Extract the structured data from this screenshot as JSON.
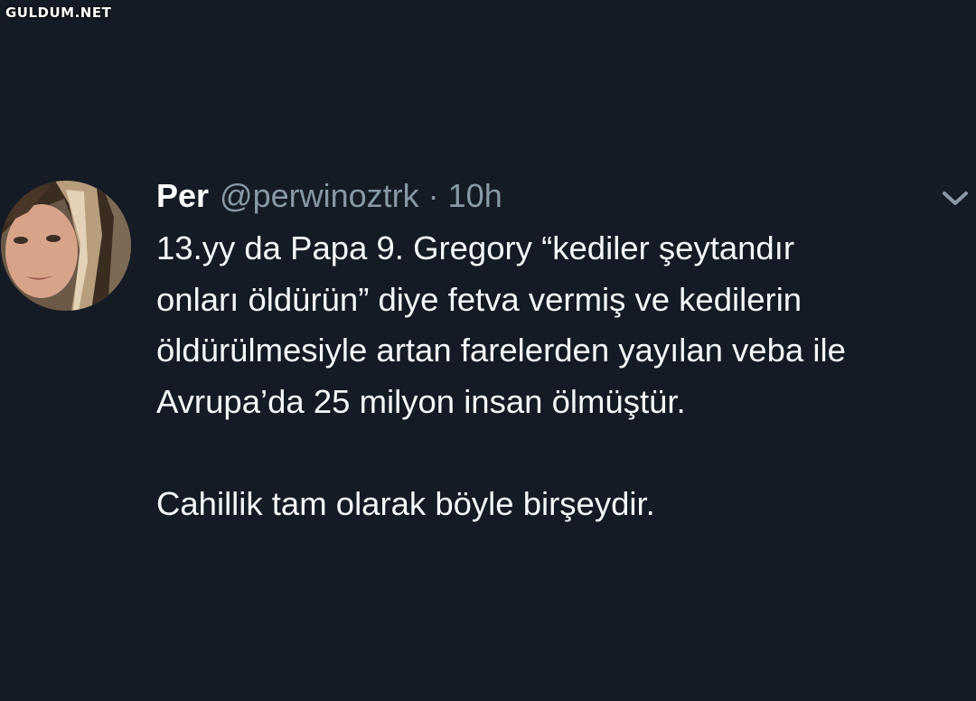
{
  "watermark": "GULDUM.NET",
  "tweet": {
    "avatar_icon": "user-avatar-photo",
    "author_name": "Per",
    "author_handle": "@perwinoztrk",
    "separator": "·",
    "timestamp": "10h",
    "menu_icon": "chevron-down-icon",
    "body_lines": [
      "13.yy da Papa 9. Gregory “kediler şeytandır",
      "onları öldürün” diye fetva vermiş ve kedilerin",
      "öldürülmesiyle artan farelerden yayılan veba ile",
      "Avrupa’da 25 milyon insan ölmüştür."
    ],
    "body_closing": "Cahillik tam olarak böyle birşeydir."
  },
  "colors": {
    "background": "#151b24",
    "text_primary": "#f5f8fa",
    "text_secondary": "#8899a6"
  }
}
